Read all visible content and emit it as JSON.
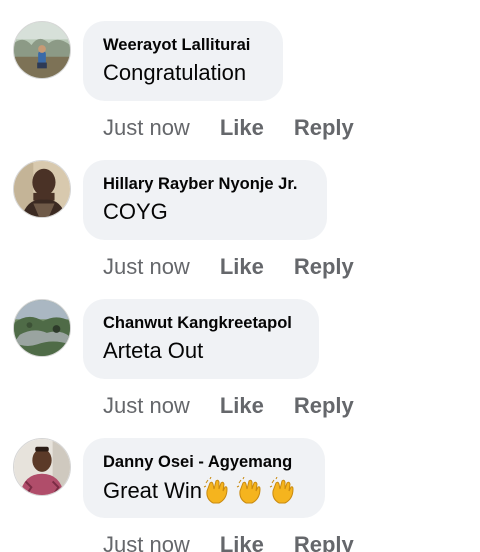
{
  "comments": [
    {
      "author": "Weerayot Lalliturai",
      "text": "Congratulation",
      "time": "Just now",
      "like_label": "Like",
      "reply_label": "Reply",
      "emojis": []
    },
    {
      "author": "Hillary Rayber Nyonje Jr.",
      "text": "COYG",
      "time": "Just now",
      "like_label": "Like",
      "reply_label": "Reply",
      "emojis": []
    },
    {
      "author": "Chanwut Kangkreetapol",
      "text": "Arteta Out",
      "time": "Just now",
      "like_label": "Like",
      "reply_label": "Reply",
      "emojis": []
    },
    {
      "author": "Danny Osei - Agyemang",
      "text": "Great Win",
      "time": "Just now",
      "like_label": "Like",
      "reply_label": "Reply",
      "emojis": [
        "clapping-hands",
        "clapping-hands",
        "clapping-hands"
      ]
    }
  ],
  "colors": {
    "bubble_bg": "#f0f2f5",
    "action_text": "#65676b",
    "primary_text": "#050505"
  }
}
